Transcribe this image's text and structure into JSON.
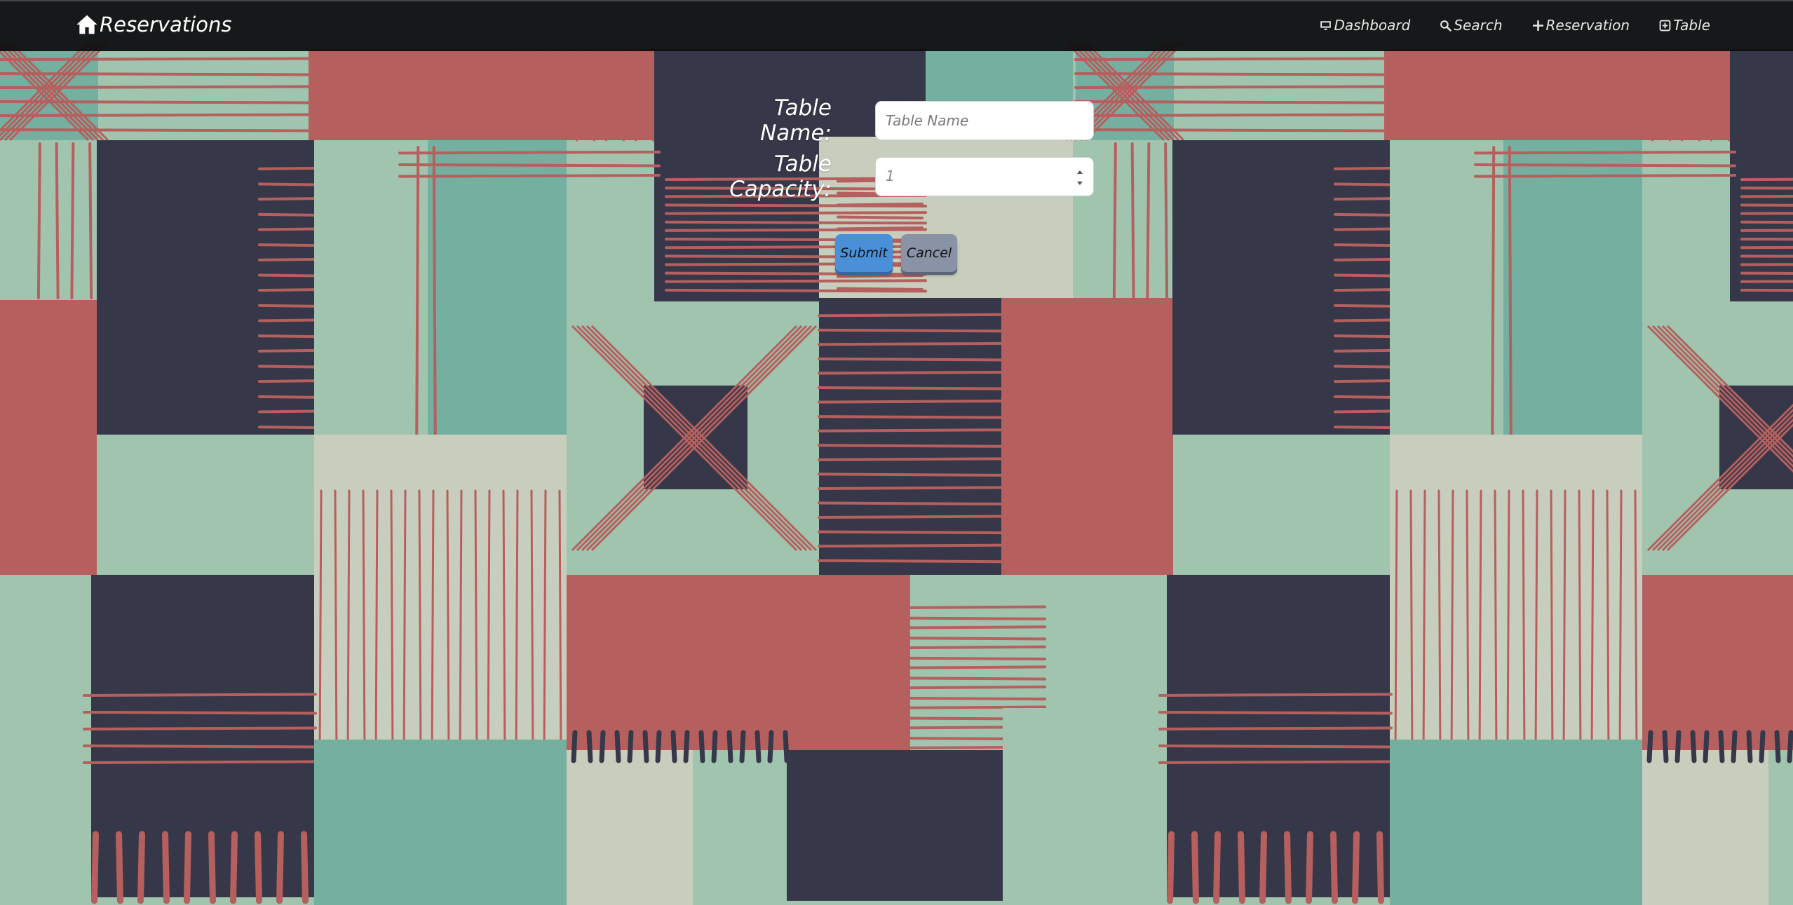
{
  "navbar": {
    "brand": "Reservations",
    "brand_icon": "home-icon",
    "links": [
      {
        "label": "Dashboard",
        "icon": "dashboard-icon"
      },
      {
        "label": "Search",
        "icon": "search-icon"
      },
      {
        "label": "Reservation",
        "icon": "plus-icon"
      },
      {
        "label": "Table",
        "icon": "plus-square-icon"
      }
    ]
  },
  "form": {
    "table_name": {
      "label": "Table Name:",
      "placeholder": "Table Name",
      "value": ""
    },
    "table_capacity": {
      "label": "Table Capacity:",
      "value": "1"
    },
    "submit_label": "Submit",
    "cancel_label": "Cancel"
  },
  "colors": {
    "navbar": "#0c0c0e",
    "navy": "#363849",
    "coral": "#b5605e",
    "mint": "#a0c4ae",
    "teal": "#74afa0",
    "beige": "#c8cebd",
    "submit": "#4a90d9",
    "cancel": "#8a92a6"
  }
}
